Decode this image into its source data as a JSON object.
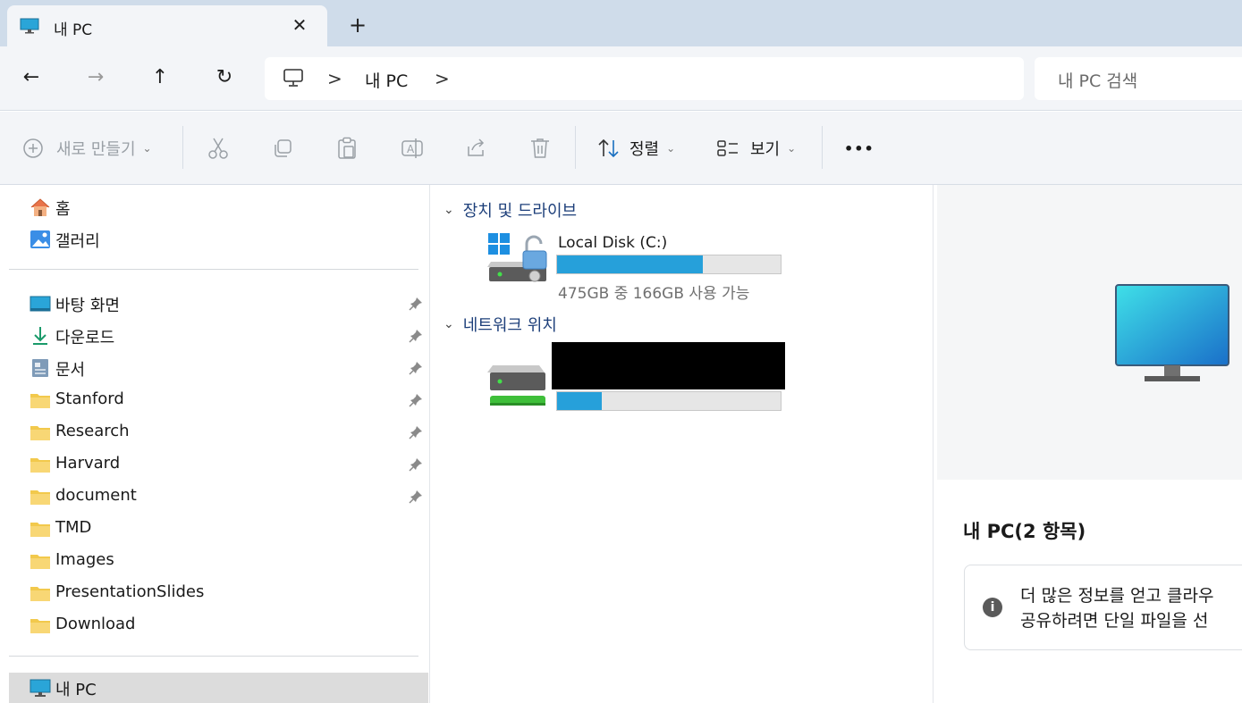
{
  "tab": {
    "title": "내 PC",
    "close_icon": "close-icon",
    "new_tab_label": "+"
  },
  "nav": {
    "back_icon": "back-arrow-icon",
    "forward_icon": "forward-arrow-icon",
    "up_icon": "up-arrow-icon",
    "refresh_icon": "refresh-icon",
    "address": {
      "segments": [
        "내 PC"
      ],
      "separator": ">"
    },
    "search_placeholder": "내 PC 검색"
  },
  "commands": {
    "new_label": "새로 만들기",
    "sort_label": "정렬",
    "view_label": "보기",
    "more_label": "•••"
  },
  "sidebar": {
    "top_items": [
      {
        "label": "홈",
        "icon": "home-icon"
      },
      {
        "label": "갤러리",
        "icon": "gallery-icon"
      }
    ],
    "pinned_items": [
      {
        "label": "바탕 화면",
        "icon": "desktop-icon",
        "pinned": true
      },
      {
        "label": "다운로드",
        "icon": "download-icon",
        "pinned": true
      },
      {
        "label": "문서",
        "icon": "documents-icon",
        "pinned": true
      },
      {
        "label": "Stanford",
        "icon": "folder-icon",
        "pinned": true
      },
      {
        "label": "Research",
        "icon": "folder-icon",
        "pinned": true
      },
      {
        "label": "Harvard",
        "icon": "folder-icon",
        "pinned": true
      },
      {
        "label": "document",
        "icon": "folder-icon",
        "pinned": true
      },
      {
        "label": "TMD",
        "icon": "folder-icon",
        "pinned": false
      },
      {
        "label": "Images",
        "icon": "folder-icon",
        "pinned": false
      },
      {
        "label": "PresentationSlides",
        "icon": "folder-icon",
        "pinned": false
      },
      {
        "label": "Download",
        "icon": "folder-icon",
        "pinned": false
      }
    ],
    "this_pc_label": "내 PC"
  },
  "content": {
    "devices_header": "장치 및 드라이브",
    "network_header": "네트워크 위치",
    "local_disk": {
      "name": "Local Disk (C:)",
      "usage_text": "475GB 중 166GB 사용 가능",
      "used_fraction": 0.65
    },
    "network_drive": {
      "used_fraction": 0.2
    }
  },
  "details": {
    "title": "내 PC(2 항목)",
    "info_line1": "더 많은 정보를 얻고 클라우",
    "info_line2": "공유하려면 단일 파일을 선"
  },
  "colors": {
    "accent": "#26a0da",
    "header_blue": "#1d3f7a",
    "tabstrip": "#cfdcea",
    "chrome": "#f3f5f8"
  }
}
